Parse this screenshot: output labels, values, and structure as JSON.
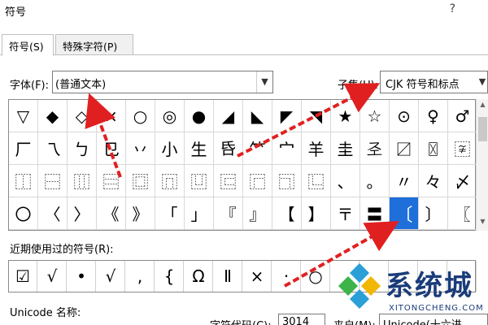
{
  "window": {
    "title": "符号",
    "help": "?"
  },
  "tabs": [
    {
      "label": "符号(S)"
    },
    {
      "label": "特殊字符(P)"
    }
  ],
  "font": {
    "label": "字体(F):",
    "value": "(普通文本)"
  },
  "subset": {
    "label": "子集(U):",
    "value": "CJK 符号和标点"
  },
  "grid": {
    "rows": [
      [
        "▽",
        "◆",
        "◇",
        "×",
        "○",
        "◎",
        "●",
        "◢",
        "◣",
        "◤",
        "◥",
        "★",
        "☆",
        "⊙",
        "♀",
        "♂"
      ],
      [
        "厂",
        "乁",
        "ㄅ",
        "㔾",
        "丷",
        "小",
        "生",
        "𠯑",
        "𥫗",
        "宀",
        "羊",
        "圭",
        "𢀖",
        "〼",
        "〿",
        "〾"
      ],
      [
        "⿰",
        "⿱",
        "⿲",
        "⿳",
        "⿴",
        "⿵",
        "⿶",
        "⿷",
        "⿸",
        "⿹",
        "⿺",
        "、",
        "。",
        "〃",
        "々",
        "〆"
      ],
      [
        "〇",
        "〈",
        "〉",
        "《",
        "》",
        "「",
        "」",
        "『",
        "』",
        "【",
        "】",
        "〒",
        "〓",
        "〔",
        "〕",
        "〖"
      ]
    ],
    "selected": {
      "row": 3,
      "col": 13
    }
  },
  "recent": {
    "label": "近期使用过的符号(R):",
    "items": [
      "☑",
      "√",
      "•",
      "√",
      ",",
      "{",
      "Ω",
      "Ⅱ",
      "×",
      "·",
      "○",
      "",
      "",
      "",
      "",
      ""
    ]
  },
  "unicode_name": {
    "label": "Unicode 名称:"
  },
  "char_code": {
    "label": "字符代码(C):",
    "value": "3014"
  },
  "from": {
    "label": "来自(M):",
    "value": "Unicode(十六进"
  },
  "watermark": {
    "text": "系统城",
    "sub": "XITONGCHENG.COM"
  },
  "colors": {
    "selection": "#1e6fd9",
    "arrow": "#e02020",
    "watermark": "#1a3c7a"
  }
}
